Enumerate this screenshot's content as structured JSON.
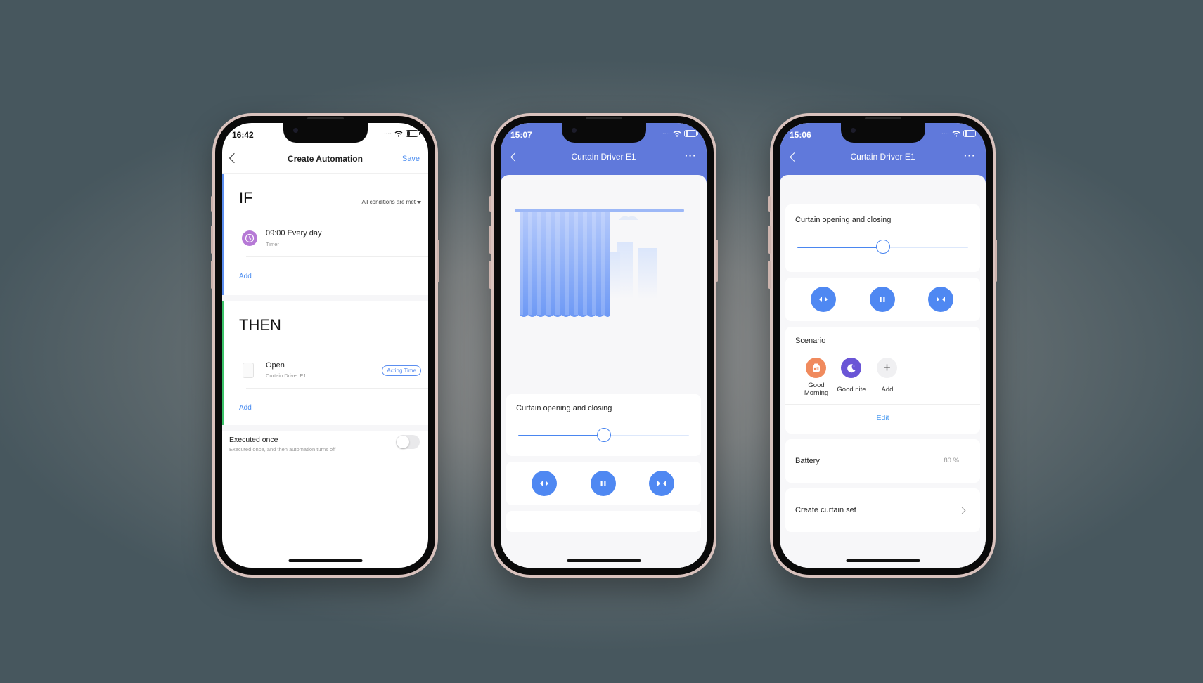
{
  "phones": [
    {
      "status": {
        "time": "16:42"
      },
      "nav": {
        "title": "Create Automation",
        "save_label": "Save"
      },
      "if_section": {
        "heading": "IF",
        "condition_mode": "All conditions are met",
        "items": [
          {
            "title": "09:00 Every day",
            "subtitle": "Timer",
            "icon": "clock-icon"
          }
        ],
        "add_label": "Add"
      },
      "then_section": {
        "heading": "THEN",
        "items": [
          {
            "title": "Open",
            "subtitle": "Curtain Driver E1",
            "icon": "curtain-device-icon",
            "badge": "Acting Time"
          }
        ],
        "add_label": "Add"
      },
      "executed_once": {
        "title": "Executed once",
        "subtitle": "Executed once, and then automation turns off",
        "enabled": false
      }
    },
    {
      "status": {
        "time": "15:07"
      },
      "nav": {
        "title": "Curtain Driver E1",
        "more_label": "···"
      },
      "curtain_card": {
        "label": "Curtain opening and closing",
        "position_percent": 50
      },
      "controls": [
        "open-icon",
        "pause-icon",
        "close-icon"
      ]
    },
    {
      "status": {
        "time": "15:06"
      },
      "nav": {
        "title": "Curtain Driver E1",
        "more_label": "···"
      },
      "curtain_card": {
        "label": "Curtain opening and closing",
        "position_percent": 50
      },
      "controls": [
        "open-icon",
        "pause-icon",
        "close-icon"
      ],
      "scenario": {
        "title": "Scenario",
        "items": [
          {
            "label": "Good Morning",
            "icon": "toaster-icon",
            "color": "#f08a5d"
          },
          {
            "label": "Good nite",
            "icon": "moon-icon",
            "color": "#6a55d6"
          },
          {
            "label": "Add",
            "icon": "plus-icon",
            "color": "#f0f0f2"
          }
        ],
        "edit_label": "Edit"
      },
      "battery": {
        "label": "Battery",
        "value": "80 %"
      },
      "curtain_set": {
        "label": "Create curtain set"
      }
    }
  ],
  "colors": {
    "accent_blue": "#4a86f0",
    "header_blue": "#6079db",
    "if_bar": "#5b8ef0",
    "then_bar": "#3cc46a"
  }
}
